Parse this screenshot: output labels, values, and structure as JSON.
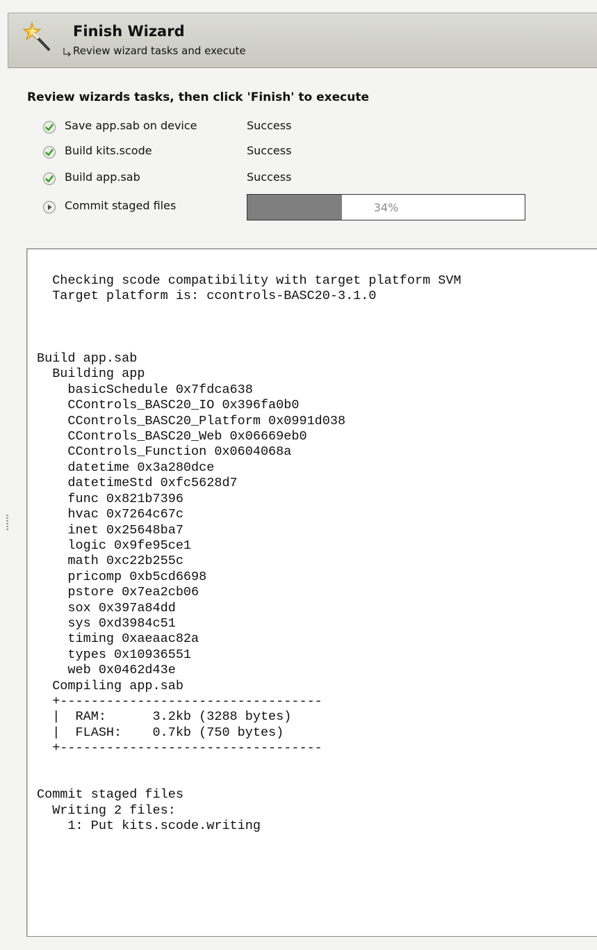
{
  "header": {
    "title": "Finish Wizard",
    "subtitle": "Review wizard tasks and execute",
    "icon": "magic-wand-icon"
  },
  "review_heading": "Review wizards tasks, then click 'Finish' to execute",
  "tasks": [
    {
      "label": "Save app.sab on device",
      "status": "Success",
      "icon": "check-icon"
    },
    {
      "label": "Build kits.scode",
      "status": "Success",
      "icon": "check-icon"
    },
    {
      "label": "Build app.sab",
      "status": "Success",
      "icon": "check-icon"
    },
    {
      "label": "Commit staged files",
      "icon": "play-icon",
      "progress": {
        "value": 0.34,
        "label": "34%"
      }
    }
  ],
  "colors": {
    "check_green": "#3a9a2a",
    "progress_fill": "#7f7f7f",
    "header_bg": "#d2d2cb"
  },
  "log": {
    "lines": [
      "  Checking scode compatibility with target platform SVM",
      "  Target platform is: ccontrols-BASC20-3.1.0",
      "",
      "",
      "",
      "Build app.sab",
      "  Building app",
      "    basicSchedule 0x7fdca638",
      "    CControls_BASC20_IO 0x396fa0b0",
      "    CControls_BASC20_Platform 0x0991d038",
      "    CControls_BASC20_Web 0x06669eb0",
      "    CControls_Function 0x0604068a",
      "    datetime 0x3a280dce",
      "    datetimeStd 0xfc5628d7",
      "    func 0x821b7396",
      "    hvac 0x7264c67c",
      "    inet 0x25648ba7",
      "    logic 0x9fe95ce1",
      "    math 0xc22b255c",
      "    pricomp 0xb5cd6698",
      "    pstore 0x7ea2cb06",
      "    sox 0x397a84dd",
      "    sys 0xd3984c51",
      "    timing 0xaeaac82a",
      "    types 0x10936551",
      "    web 0x0462d43e",
      "  Compiling app.sab",
      "  +----------------------------------",
      "  |  RAM:      3.2kb (3288 bytes)",
      "  |  FLASH:    0.7kb (750 bytes)",
      "  +----------------------------------",
      "",
      "",
      "Commit staged files",
      "  Writing 2 files:",
      "    1: Put kits.scode.writing"
    ]
  }
}
